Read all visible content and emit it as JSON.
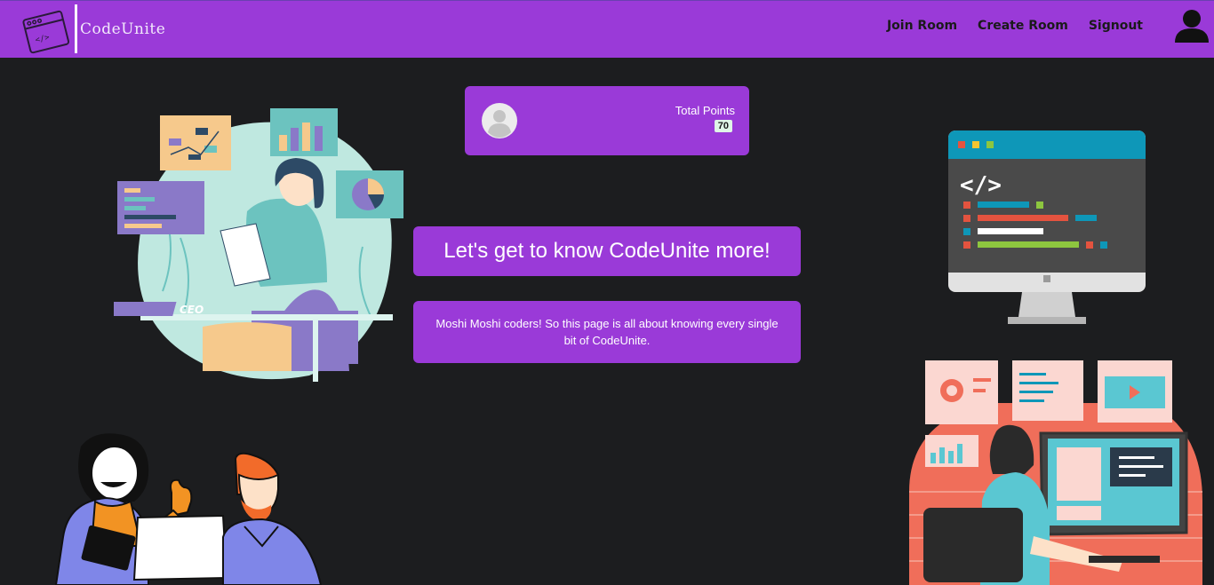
{
  "navbar": {
    "brand": "CodeUnite",
    "links": [
      "Join Room",
      "Create Room",
      "Signout"
    ]
  },
  "points_card": {
    "label": "Total Points",
    "value": "70"
  },
  "heading": "Let's get to know CodeUnite more!",
  "description": "Moshi Moshi coders! So this page is all about knowing every single bit of CodeUnite.",
  "illustrations": {
    "ceo_badge": "CEO"
  },
  "colors": {
    "accent": "#9a3ad8",
    "background": "#1c1d1f",
    "badge_bg": "#dff6e7"
  }
}
